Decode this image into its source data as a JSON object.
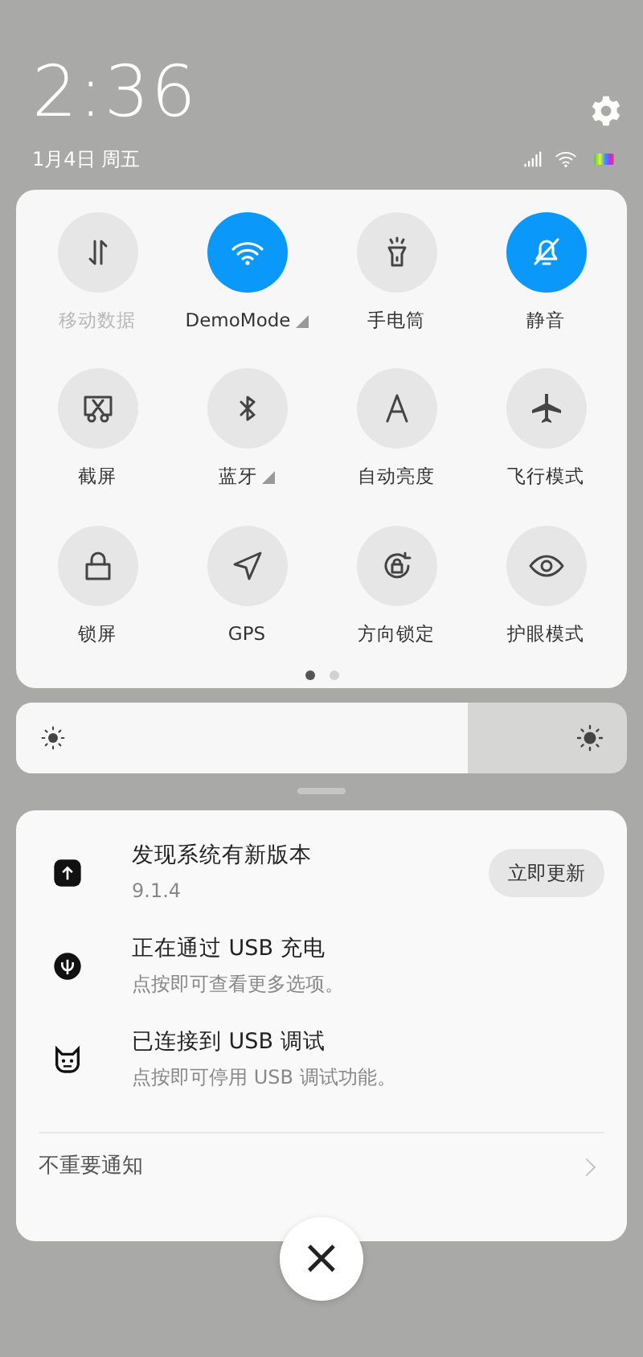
{
  "status": {
    "time": "2:36",
    "date": "1月4日 周五"
  },
  "toggles": [
    {
      "label": "移动数据",
      "on": false,
      "disabled": true,
      "more": false
    },
    {
      "label": "DemoMode",
      "on": true,
      "disabled": false,
      "more": true
    },
    {
      "label": "手电筒",
      "on": false,
      "disabled": false,
      "more": false
    },
    {
      "label": "静音",
      "on": true,
      "disabled": false,
      "more": false
    },
    {
      "label": "截屏",
      "on": false,
      "disabled": false,
      "more": false
    },
    {
      "label": "蓝牙",
      "on": false,
      "disabled": false,
      "more": true
    },
    {
      "label": "自动亮度",
      "on": false,
      "disabled": false,
      "more": false
    },
    {
      "label": "飞行模式",
      "on": false,
      "disabled": false,
      "more": false
    },
    {
      "label": "锁屏",
      "on": false,
      "disabled": false,
      "more": false
    },
    {
      "label": "GPS",
      "on": false,
      "disabled": false,
      "more": false
    },
    {
      "label": "方向锁定",
      "on": false,
      "disabled": false,
      "more": false
    },
    {
      "label": "护眼模式",
      "on": false,
      "disabled": false,
      "more": false
    }
  ],
  "pages": [
    {
      "selected": true
    },
    {
      "selected": false
    }
  ],
  "brightness": {
    "level": 0.74
  },
  "notifications": [
    {
      "title": "发现系统有新版本",
      "text": "9.1.4",
      "action": "立即更新"
    },
    {
      "title": "正在通过 USB 充电",
      "text": "点按即可查看更多选项。"
    },
    {
      "title": "已连接到 USB 调试",
      "text": "点按即可停用 USB 调试功能。"
    }
  ],
  "footer": {
    "label": "不重要通知"
  },
  "close": {
    "label": "×"
  }
}
